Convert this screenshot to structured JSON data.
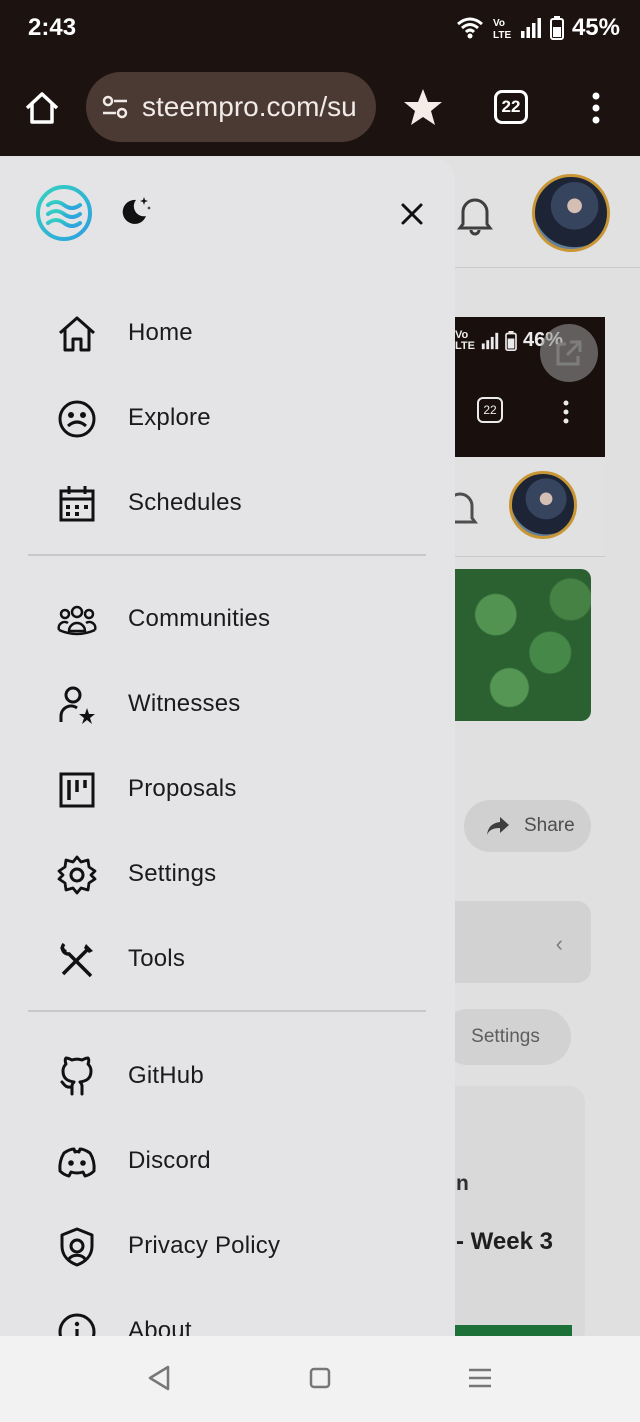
{
  "status_bar": {
    "time": "2:43",
    "battery": "45%",
    "network": "LTE",
    "icons": [
      "wifi-icon",
      "volte-icon",
      "signal-icon",
      "battery-icon"
    ]
  },
  "browser": {
    "url": "steempro.com/su",
    "tab_count": "22",
    "icons": [
      "home-icon",
      "site-settings-icon",
      "star-icon",
      "tabs-icon",
      "overflow-menu-icon"
    ]
  },
  "background_page": {
    "nested_battery": "46%",
    "nested_tab_count": "22",
    "share_label": "Share",
    "settings_label": "Settings",
    "card_text_1": "n",
    "card_text_2": "- Week 3"
  },
  "drawer": {
    "icons": [
      "steempro-logo-icon",
      "dark-mode-icon",
      "close-icon"
    ],
    "sections": [
      {
        "items": [
          {
            "label": "Home",
            "icon": "home-icon"
          },
          {
            "label": "Explore",
            "icon": "explore-icon"
          },
          {
            "label": "Schedules",
            "icon": "calendar-icon"
          }
        ]
      },
      {
        "items": [
          {
            "label": "Communities",
            "icon": "communities-icon"
          },
          {
            "label": "Witnesses",
            "icon": "witness-icon"
          },
          {
            "label": "Proposals",
            "icon": "proposals-icon"
          },
          {
            "label": "Settings",
            "icon": "gear-icon"
          },
          {
            "label": "Tools",
            "icon": "tools-icon"
          }
        ]
      },
      {
        "items": [
          {
            "label": "GitHub",
            "icon": "github-icon"
          },
          {
            "label": "Discord",
            "icon": "discord-icon"
          },
          {
            "label": "Privacy Policy",
            "icon": "shield-icon"
          },
          {
            "label": "About",
            "icon": "info-icon"
          }
        ]
      }
    ]
  },
  "system_nav": {
    "icons": [
      "back-icon",
      "home-square-icon",
      "recents-icon"
    ]
  },
  "colors": {
    "browser_bar": "#1c1210",
    "url_pill": "#4a3a33",
    "drawer_bg": "#e4e4e6",
    "logo_gradient_start": "#34d2c0",
    "logo_gradient_end": "#2e9fe0",
    "avatar_ring": "#d9a33a"
  }
}
